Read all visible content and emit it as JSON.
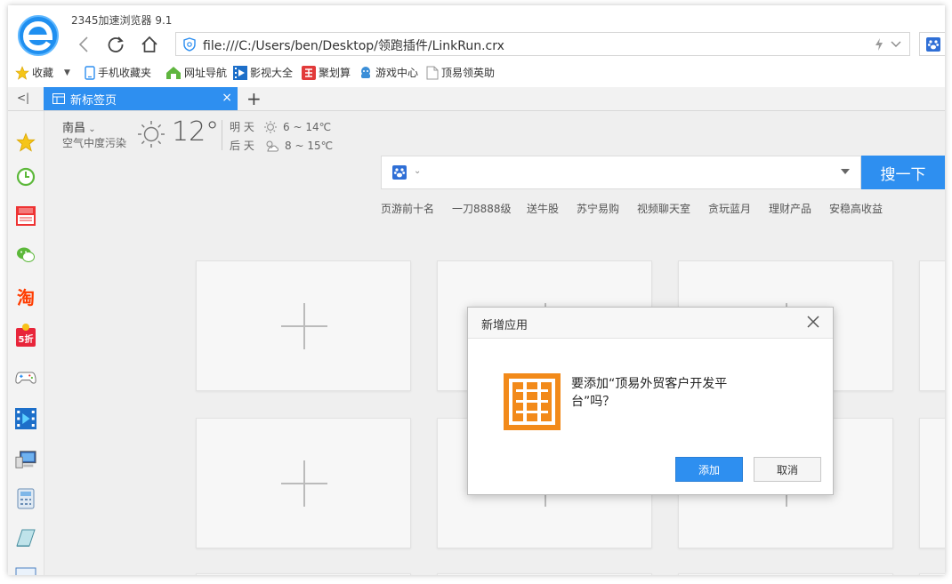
{
  "window": {
    "title": "2345加速浏览器 9.1"
  },
  "address": {
    "url": "file:///C:/Users/ben/Desktop/领跑插件/LinkRun.crx"
  },
  "bookmarks": [
    {
      "label": "收藏",
      "icon": "star-icon"
    },
    {
      "label": "手机收藏夹",
      "icon": "phone-icon"
    },
    {
      "label": "网址导航",
      "icon": "house-icon"
    },
    {
      "label": "影视大全",
      "icon": "film-icon"
    },
    {
      "label": "聚划算",
      "icon": "juhuasuan-icon"
    },
    {
      "label": "游戏中心",
      "icon": "game-icon"
    },
    {
      "label": "顶易领英助",
      "icon": "page-icon"
    }
  ],
  "tabs": {
    "toggle": "<|",
    "active_label": "新标签页",
    "close": "×",
    "new": "+"
  },
  "weather": {
    "city": "南昌",
    "air": "空气中度污染",
    "temp": "12°",
    "forecast": [
      {
        "day": "明 天",
        "range": "6 ~ 14℃"
      },
      {
        "day": "后 天",
        "range": "8 ~ 15℃"
      }
    ]
  },
  "search": {
    "button": "搜一下"
  },
  "hot_links": [
    "页游前十名",
    "一刀8888级",
    "送牛股",
    "苏宁易购",
    "视频聊天室",
    "贪玩蓝月",
    "理财产品",
    "安稳高收益"
  ],
  "dialog": {
    "title": "新增应用",
    "message": "要添加“顶易外贸客户开发平台”吗？",
    "add": "添加",
    "cancel": "取消"
  },
  "colors": {
    "accent": "#2e8ff0",
    "app_icon": "#f28a1a"
  }
}
